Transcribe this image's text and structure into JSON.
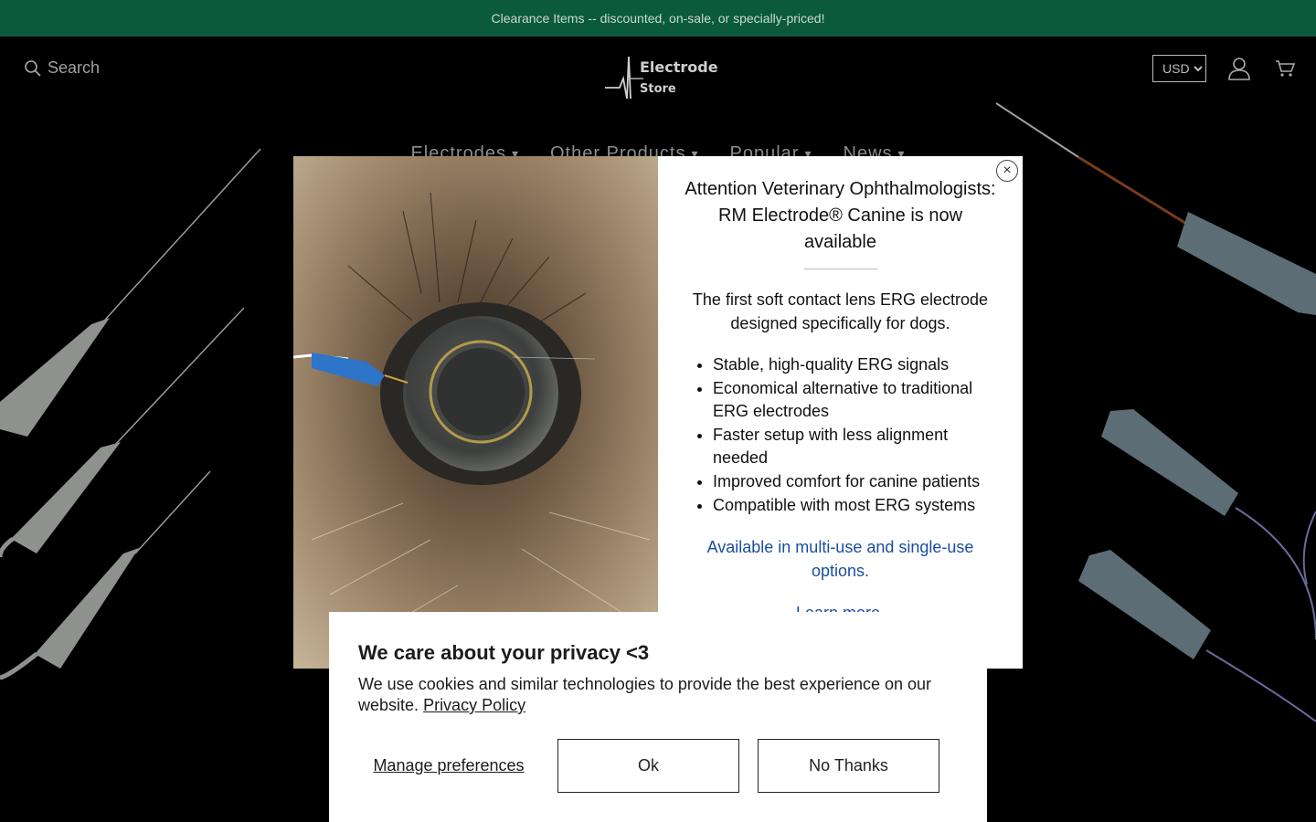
{
  "announcement": {
    "text": "Clearance Items -- discounted, on-sale, or specially-priced!"
  },
  "header": {
    "search_placeholder": "Search",
    "logo": {
      "line1": "Electrode",
      "line2": "Store"
    },
    "currency": {
      "selected": "USD",
      "options": [
        "USD"
      ]
    },
    "icons": {
      "search": "search-icon",
      "account": "user-icon",
      "cart": "cart-icon"
    }
  },
  "nav": {
    "items": [
      {
        "label": "Electrodes",
        "caret": "▾"
      },
      {
        "label": "Other Products",
        "caret": "▾"
      },
      {
        "label": "Popular",
        "caret": "▾"
      },
      {
        "label": "News",
        "caret": "▾"
      }
    ]
  },
  "modal": {
    "close_glyph": "×",
    "title": "Attention Veterinary Ophthalmologists: RM Electrode® Canine is now available",
    "lead": "The first soft contact lens ERG electrode designed specifically for dogs.",
    "bullets": [
      "Stable, high-quality ERG signals",
      "Economical alternative to traditional ERG electrodes",
      "Faster setup with less alignment needed",
      "Improved comfort for canine patients",
      "Compatible with most ERG systems"
    ],
    "note": "Available in multi-use and single-use options.",
    "link": "Learn more."
  },
  "cookie": {
    "title": "We care about your privacy <3",
    "text": "We use cookies and similar technologies to provide the best experience on our website.",
    "policy_link": "Privacy Policy",
    "manage_label": "Manage preferences",
    "ok_label": "Ok",
    "no_label": "No Thanks"
  },
  "colors": {
    "announcement_bg": "#0c5a3e",
    "link_blue": "#1a4d9e",
    "page_bg": "#000000"
  }
}
